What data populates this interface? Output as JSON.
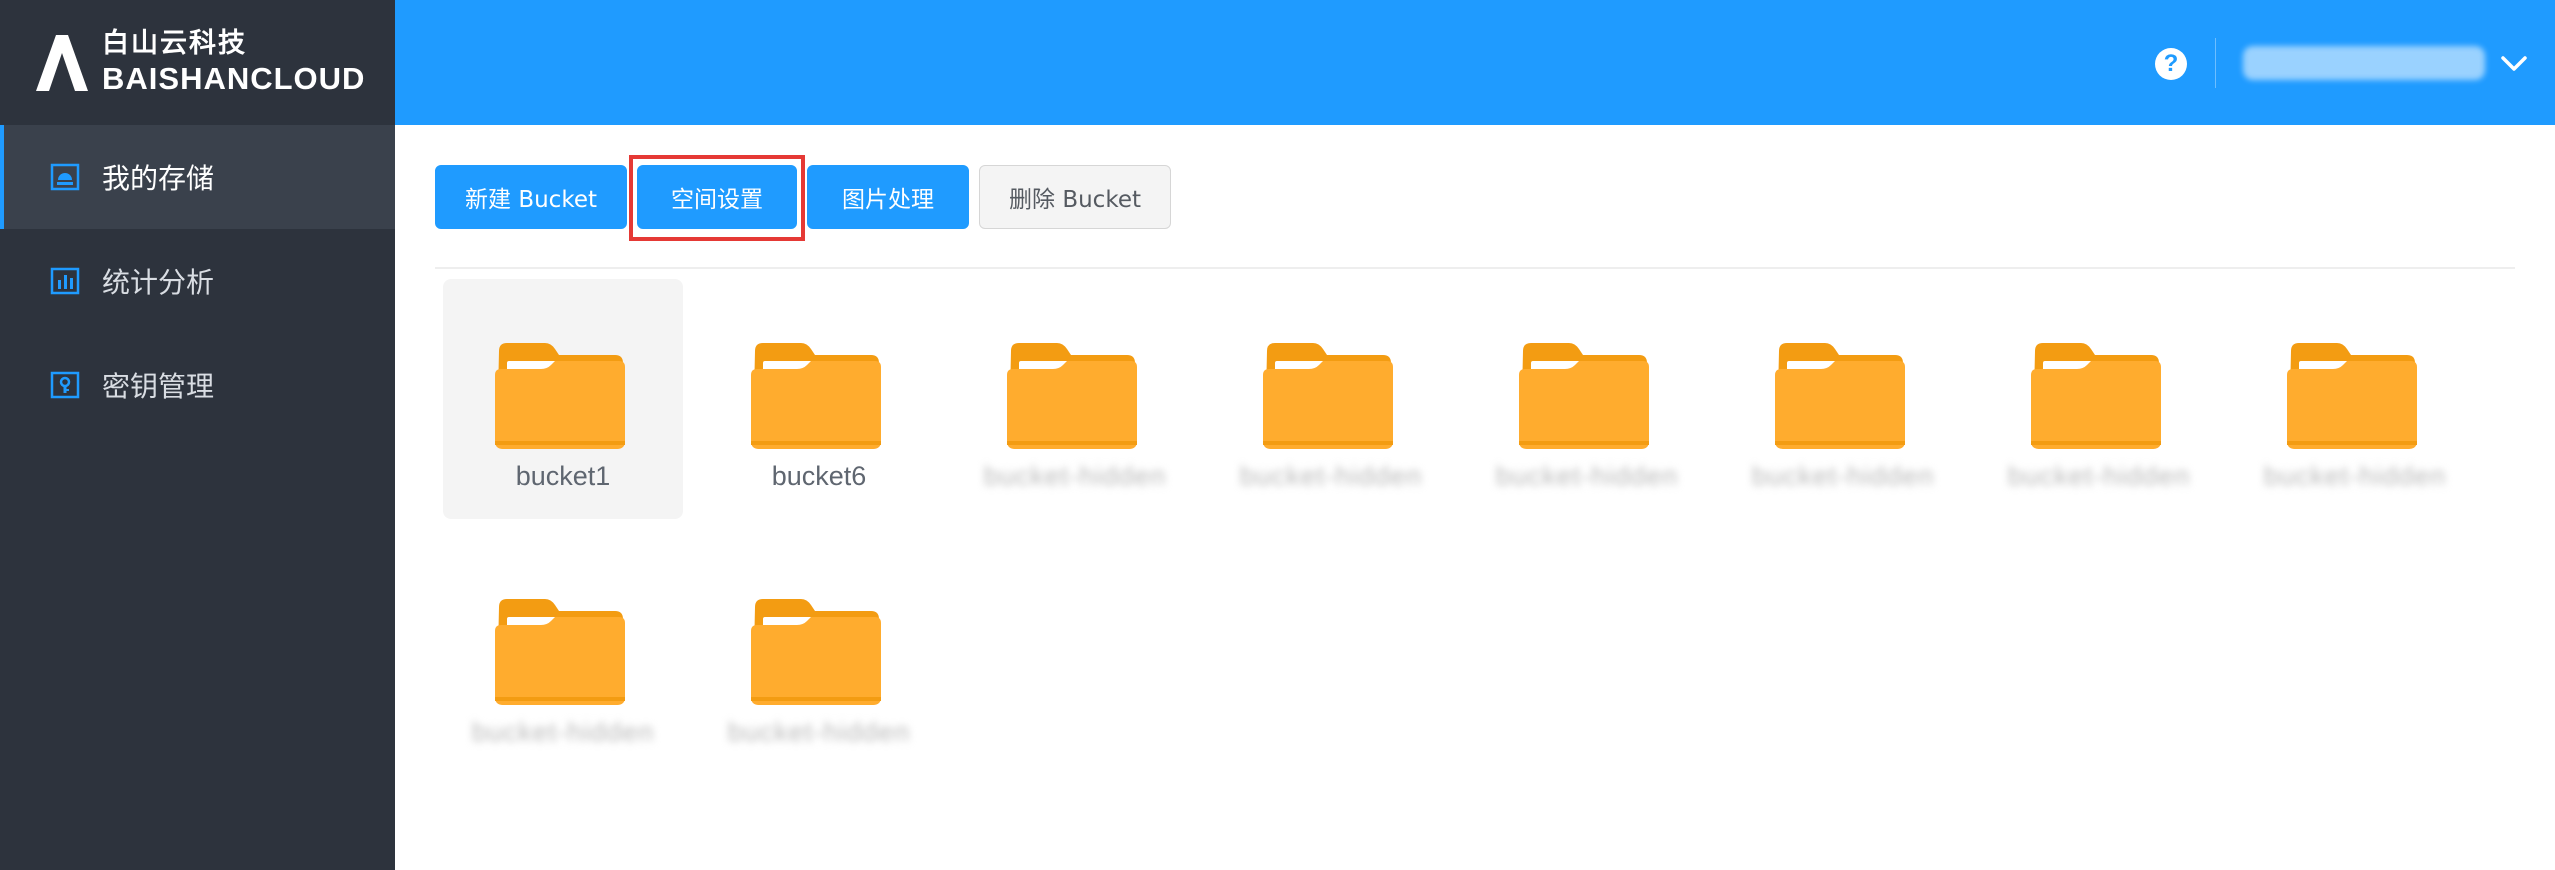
{
  "brand": {
    "name_cn": "白山云科技",
    "name_en": "BAISHANCLOUD"
  },
  "sidebar": {
    "items": [
      {
        "label": "我的存储",
        "icon": "storage-icon",
        "active": true
      },
      {
        "label": "统计分析",
        "icon": "bar-chart-icon",
        "active": false
      },
      {
        "label": "密钥管理",
        "icon": "key-icon",
        "active": false
      }
    ]
  },
  "header": {
    "help_symbol": "?",
    "user_name": "user_account",
    "chevron_icon": "chevron-down-icon"
  },
  "toolbar": {
    "new_bucket": "新建 Bucket",
    "space_settings": "空间设置",
    "image_processing": "图片处理",
    "delete_bucket": "删除 Bucket"
  },
  "buckets": [
    {
      "name": "bucket1",
      "selected": true,
      "blurred": false
    },
    {
      "name": "bucket6",
      "selected": false,
      "blurred": false
    },
    {
      "name": "bucket-hidden",
      "selected": false,
      "blurred": true
    },
    {
      "name": "bucket-hidden",
      "selected": false,
      "blurred": true
    },
    {
      "name": "bucket-hidden",
      "selected": false,
      "blurred": true
    },
    {
      "name": "bucket-hidden",
      "selected": false,
      "blurred": true
    },
    {
      "name": "bucket-hidden",
      "selected": false,
      "blurred": true
    },
    {
      "name": "bucket-hidden",
      "selected": false,
      "blurred": true
    },
    {
      "name": "bucket-hidden",
      "selected": false,
      "blurred": true
    },
    {
      "name": "bucket-hidden",
      "selected": false,
      "blurred": true
    }
  ],
  "colors": {
    "accent": "#1f9bff",
    "sidebar_bg": "#2d333d",
    "folder": "#ffac2e",
    "highlight": "#e53935"
  }
}
